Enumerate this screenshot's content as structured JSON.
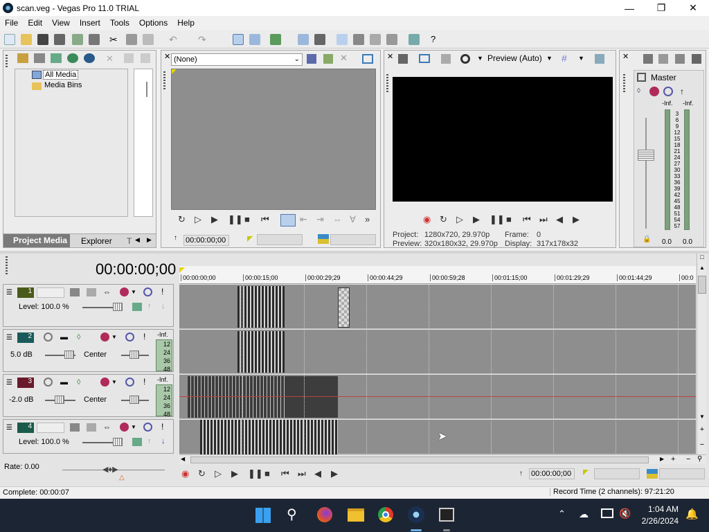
{
  "window": {
    "title": "scan.veg - Vegas Pro 11.0 TRIAL"
  },
  "menu": [
    "File",
    "Edit",
    "View",
    "Insert",
    "Tools",
    "Options",
    "Help"
  ],
  "media": {
    "tree": [
      "All Media",
      "Media Bins"
    ],
    "tabs": [
      "Project Media",
      "Explorer",
      "T"
    ]
  },
  "trimmer": {
    "dropdown": "(None)",
    "time": "00:00:00;00"
  },
  "preview": {
    "mode": "Preview (Auto)",
    "project_label": "Project:",
    "project_value": "1280x720, 29.970p",
    "preview_label": "Preview:",
    "preview_value": "320x180x32, 29.970p",
    "frame_label": "Frame:",
    "frame_value": "0",
    "display_label": "Display:",
    "display_value": "317x178x32"
  },
  "mixer": {
    "master": "Master",
    "left_db": "-Inf.",
    "right_db": "-Inf.",
    "scale": [
      "3",
      "6",
      "9",
      "12",
      "15",
      "18",
      "21",
      "24",
      "27",
      "30",
      "33",
      "36",
      "39",
      "42",
      "45",
      "48",
      "51",
      "54",
      "57"
    ],
    "left_val": "0.0",
    "right_val": "0.0"
  },
  "timeline": {
    "timecode": "00:00:00;00",
    "ruler": [
      "00:00:00;00",
      "00:00:15;00",
      "00:00:29;29",
      "00:00:44;29",
      "00:00:59;28",
      "00:01:15;00",
      "00:01:29;29",
      "00:01:44;29",
      "00:0"
    ],
    "tracks": [
      {
        "num": "1",
        "type": "video",
        "label": "Level: 100.0 %"
      },
      {
        "num": "2",
        "type": "audio",
        "label": "5.0 dB",
        "pan": "Center",
        "meter": [
          "-Inf.",
          "12",
          "24",
          "36",
          "48"
        ]
      },
      {
        "num": "3",
        "type": "audio",
        "label": "-2.0 dB",
        "pan": "Center",
        "meter": [
          "-Inf.",
          "12",
          "24",
          "36",
          "48"
        ]
      },
      {
        "num": "4",
        "type": "video",
        "label": "Level: 100.0 %"
      }
    ],
    "rate": "Rate: 0.00",
    "bottom_time": "00:00:00;00"
  },
  "status": {
    "left": "Complete: 00:00:07",
    "right": "Record Time (2 channels): 97:21:20"
  },
  "taskbar": {
    "time": "1:04 AM",
    "date": "2/26/2024"
  },
  "colors": {
    "accent": "#0a64c8",
    "timeline_bg": "#8e8e8e",
    "record": "#d03030"
  }
}
